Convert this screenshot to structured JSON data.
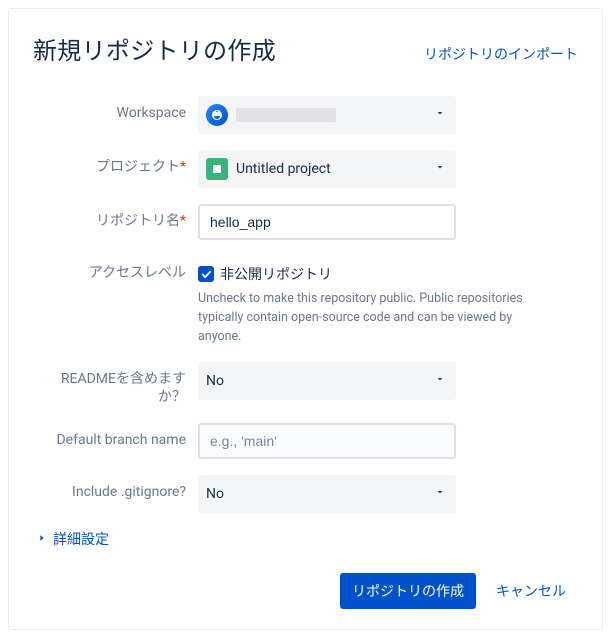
{
  "header": {
    "title": "新規リポジトリの作成",
    "import_link": "リポジトリのインポート"
  },
  "form": {
    "workspace_label": "Workspace",
    "project_label": "プロジェクト",
    "project_value": "Untitled project",
    "repo_name_label": "リポジトリ名",
    "repo_name_value": "hello_app",
    "access_label": "アクセスレベル",
    "access_checkbox_label": "非公開リポジトリ",
    "access_helper": "Uncheck to make this repository public. Public repositories typically contain open-source code and can be viewed by anyone.",
    "readme_label": "READMEを含めますか？",
    "readme_value": "No",
    "branch_label": "Default branch name",
    "branch_placeholder": "e.g., 'main'",
    "gitignore_label": "Include .gitignore?",
    "gitignore_value": "No"
  },
  "advanced_label": "詳細設定",
  "footer": {
    "submit": "リポジトリの作成",
    "cancel": "キャンセル"
  }
}
